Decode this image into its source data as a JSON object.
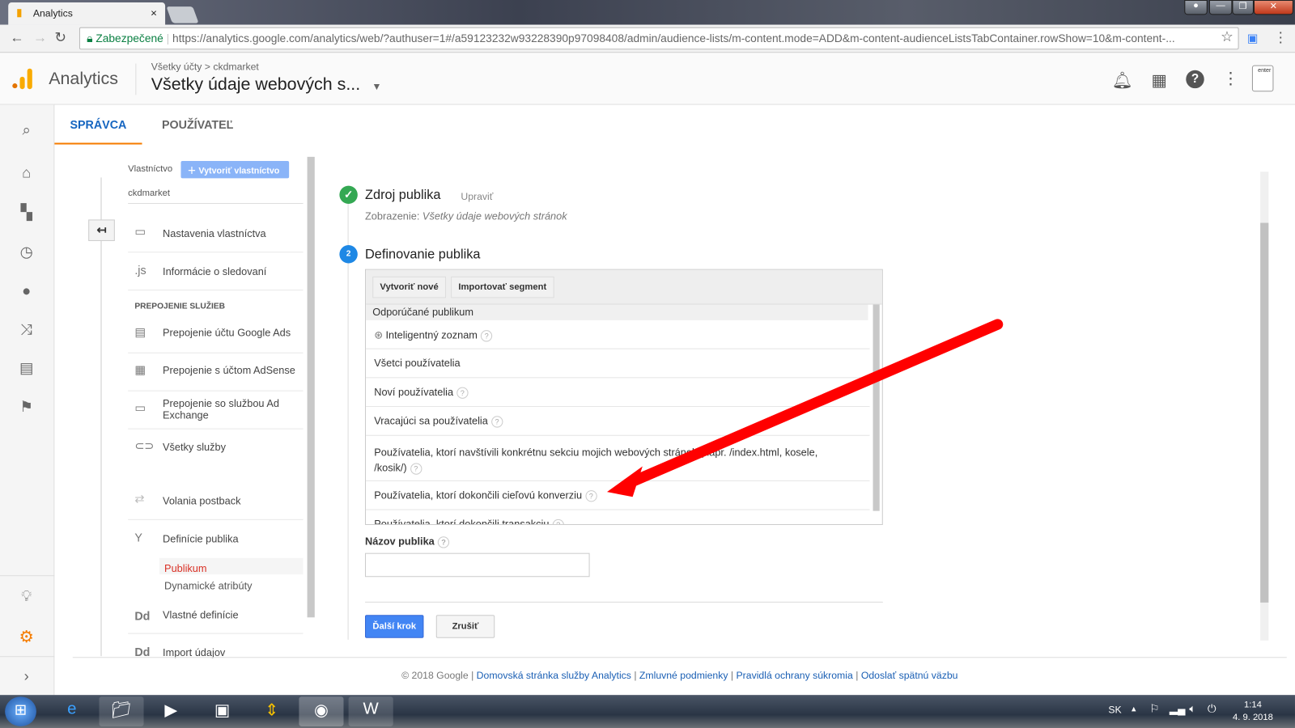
{
  "browser": {
    "tab_title": "Analytics",
    "tab_close": "×",
    "secure_label": "Zabezpečené",
    "url": "https://analytics.google.com/analytics/web/?authuser=1#/a59123232w93228390p97098408/admin/audience-lists/m-content.mode=ADD&m-content-audienceListsTabContainer.rowShow=10&m-content-..."
  },
  "header": {
    "app_name": "Analytics",
    "breadcrumb_account": "Všetky účty",
    "breadcrumb_sep": ">",
    "breadcrumb_property": "ckdmarket",
    "view_title": "Všetky údaje webových s...",
    "avatar_label": "enter"
  },
  "tabs": [
    {
      "label": "SPRÁVCA",
      "active": true
    },
    {
      "label": "POUŽÍVATEĽ",
      "active": false
    }
  ],
  "property": {
    "label": "Vlastníctvo",
    "create_button": "Vytvoriť vlastníctvo",
    "name": "ckdmarket"
  },
  "menu": {
    "items": [
      {
        "icon": "panel-icon",
        "label": "Nastavenia vlastníctva"
      },
      {
        "icon": ".js",
        "label": "Informácie o sledovaní"
      }
    ],
    "section": "PREPOJENIE SLUŽIEB",
    "services": [
      {
        "icon": "ads-icon",
        "label": "Prepojenie účtu Google Ads"
      },
      {
        "icon": "adsense-icon",
        "label": "Prepojenie s účtom AdSense"
      },
      {
        "icon": "panel-icon",
        "label": "Prepojenie so službou Ad Exchange"
      },
      {
        "icon": "link-icon",
        "label": "Všetky služby"
      }
    ],
    "more": [
      {
        "icon": "postback-icon",
        "label": "Volania postback"
      },
      {
        "icon": "fork-icon",
        "label": "Definície publika"
      }
    ],
    "sub": [
      {
        "label": "Publikum",
        "active": true
      },
      {
        "label": "Dynamické atribúty",
        "active": false
      }
    ],
    "custom": [
      {
        "icon": "Dd",
        "label": "Vlastné definície"
      },
      {
        "icon": "Dd",
        "label": "Import údajov"
      }
    ]
  },
  "step1": {
    "title": "Zdroj publika",
    "edit": "Upraviť",
    "view_label": "Zobrazenie:",
    "view_value": "Všetky údaje webových stránok"
  },
  "step2": {
    "number": "2",
    "title": "Definovanie publika",
    "create_new": "Vytvoriť nové",
    "import_segment": "Importovať segment",
    "group": "Odporúčané publikum",
    "options": [
      "Inteligentný zoznam",
      "Všetci používatelia",
      "Noví používatelia",
      "Vracajúci sa používatelia",
      "Používatelia, ktorí navštívili konkrétnu sekciu mojich webových stránok (napr. /index.html, kosele, /kosik/)",
      "Používatelia, ktorí dokončili cieľovú konverziu",
      "Používatelia, ktorí dokončili transakciu"
    ]
  },
  "name_field": {
    "label": "Názov publika",
    "value": ""
  },
  "actions": {
    "next": "Ďalší krok",
    "cancel": "Zrušiť"
  },
  "footer": {
    "copyright": "© 2018 Google",
    "links": [
      "Domovská stránka služby Analytics",
      "Zmluvné podmienky",
      "Pravidlá ochrany súkromia",
      "Odoslať spätnú väzbu"
    ],
    "sep": "|"
  },
  "taskbar": {
    "lang": "SK",
    "time": "1:14",
    "date": "4. 9. 2018"
  },
  "colors": {
    "accent": "#1a73e8",
    "tab_active": "#1565c0",
    "tab_underline": "#f57c00",
    "active_sub": "#d93025",
    "check": "#34a853",
    "annotation_arrow": "#ff0000"
  }
}
